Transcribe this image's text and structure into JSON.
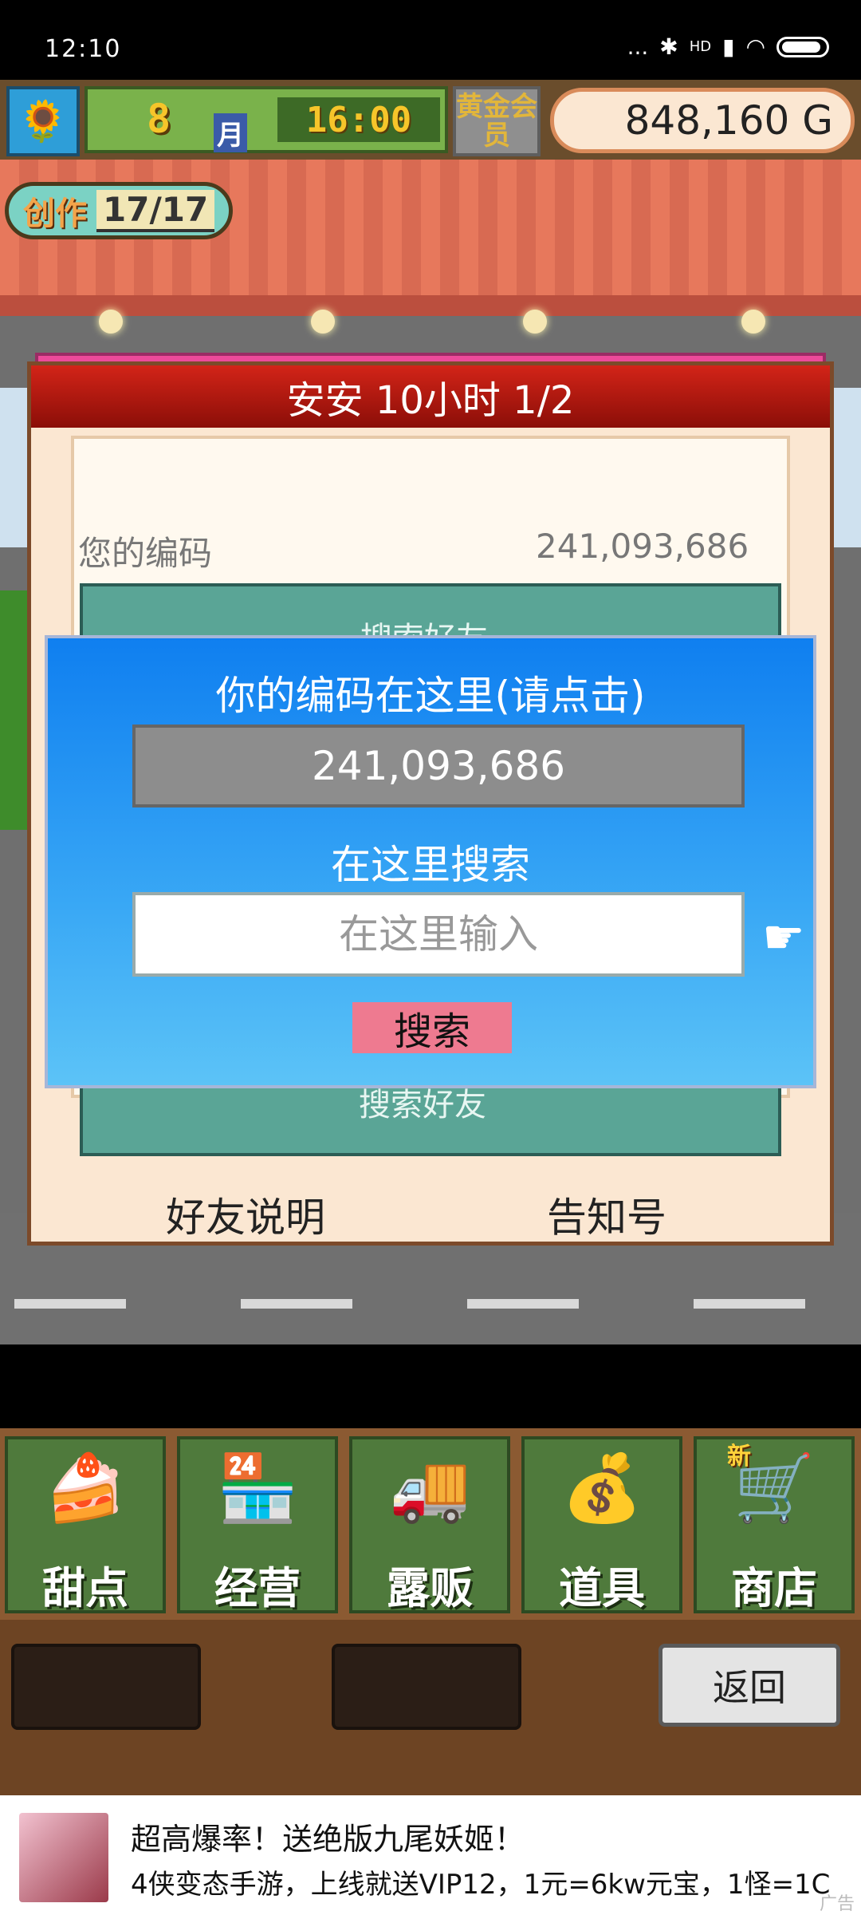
{
  "status_bar": {
    "time": "12:10",
    "signal_text": "...",
    "hd": "HD"
  },
  "hud": {
    "month_num": "8",
    "month_label": "月",
    "clock": "16:00",
    "membership": "黄金会员",
    "money": "848,160 G"
  },
  "create_badge": {
    "label": "创作",
    "count": "17/17"
  },
  "dialog": {
    "title": "安安  10小时 1/2",
    "code_label": "您的编码",
    "code_value": "241,093,686",
    "teal_top_text": "搜索好友",
    "teal_bottom_text": "搜索好友",
    "friend_help": "好友说明",
    "notice": "告知号"
  },
  "popup": {
    "title": "你的编码在这里(请点击)",
    "code": "241,093,686",
    "search_label": "在这里搜索",
    "input_placeholder": "在这里输入",
    "search_button": "搜索"
  },
  "nav": {
    "items": [
      {
        "label": "甜点",
        "icon": "cake-icon",
        "glyph": "🍰"
      },
      {
        "label": "经营",
        "icon": "shop-building-icon",
        "glyph": "🏪"
      },
      {
        "label": "露贩",
        "icon": "food-truck-icon",
        "glyph": "🚚"
      },
      {
        "label": "道具",
        "icon": "item-bag-icon",
        "glyph": "💰"
      },
      {
        "label": "商店",
        "icon": "shopping-cart-icon",
        "glyph": "🛒",
        "badge": "新"
      }
    ],
    "back": "返回"
  },
  "ad": {
    "title": "超高爆率！送绝版九尾妖姬！",
    "subtitle": "4侠变态手游，上线就送VIP12，1元=6kw元宝，1怪=1C",
    "tag": "广告"
  }
}
